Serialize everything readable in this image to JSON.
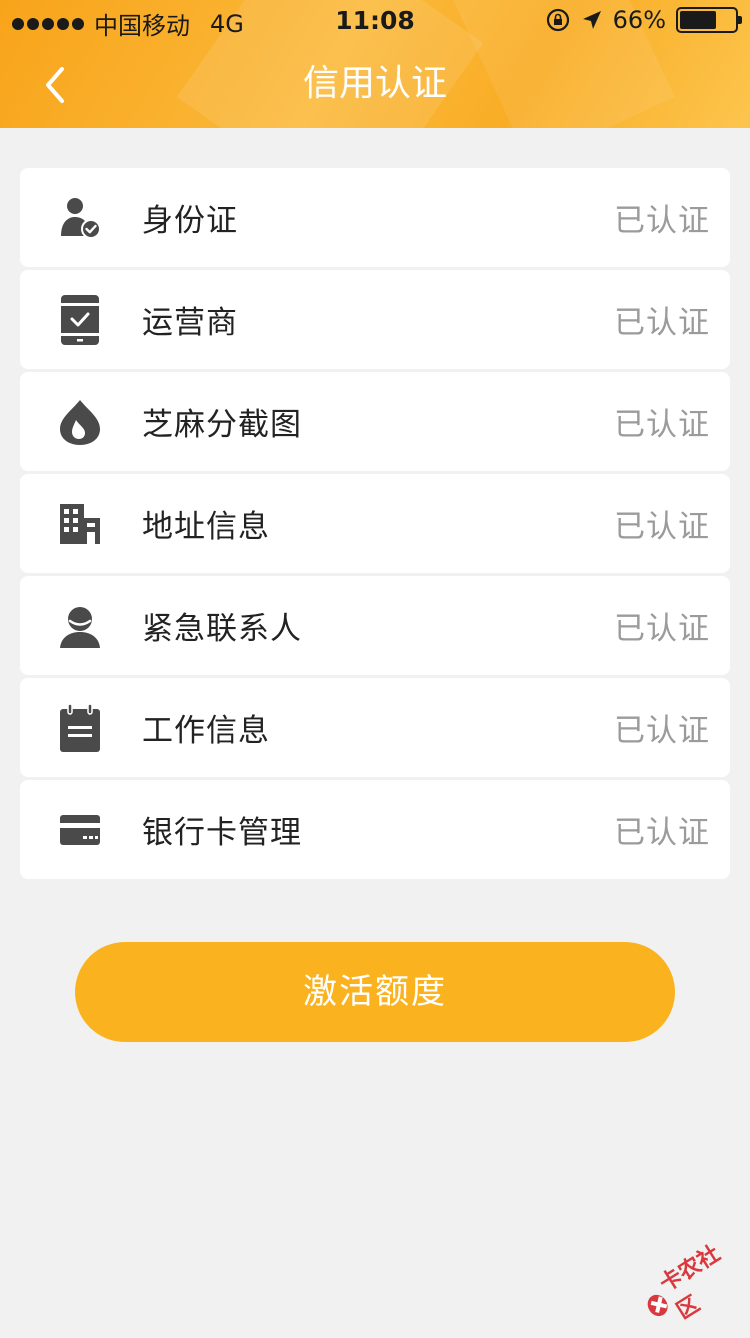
{
  "status_bar": {
    "carrier": "中国移动",
    "network": "4G",
    "time": "11:08",
    "battery": "66%",
    "battery_level": 0.66
  },
  "nav": {
    "title": "信用认证",
    "back_icon": "chevron-left-icon"
  },
  "items": [
    {
      "label": "身份证",
      "status": "已认证",
      "icon": "user-check-icon"
    },
    {
      "label": "运营商",
      "status": "已认证",
      "icon": "phone-check-icon"
    },
    {
      "label": "芝麻分截图",
      "status": "已认证",
      "icon": "drop-icon"
    },
    {
      "label": "地址信息",
      "status": "已认证",
      "icon": "building-icon"
    },
    {
      "label": "紧急联系人",
      "status": "已认证",
      "icon": "contact-person-icon"
    },
    {
      "label": "工作信息",
      "status": "已认证",
      "icon": "notepad-icon"
    },
    {
      "label": "银行卡管理",
      "status": "已认证",
      "icon": "bank-card-icon"
    }
  ],
  "activate_button": {
    "label": "激活额度"
  },
  "watermark": {
    "text": "卡农社区"
  },
  "colors": {
    "accent": "#fbb21f",
    "icon": "#4a4a4a",
    "status_text": "#9b9b9b",
    "background": "#f1f1f1"
  }
}
